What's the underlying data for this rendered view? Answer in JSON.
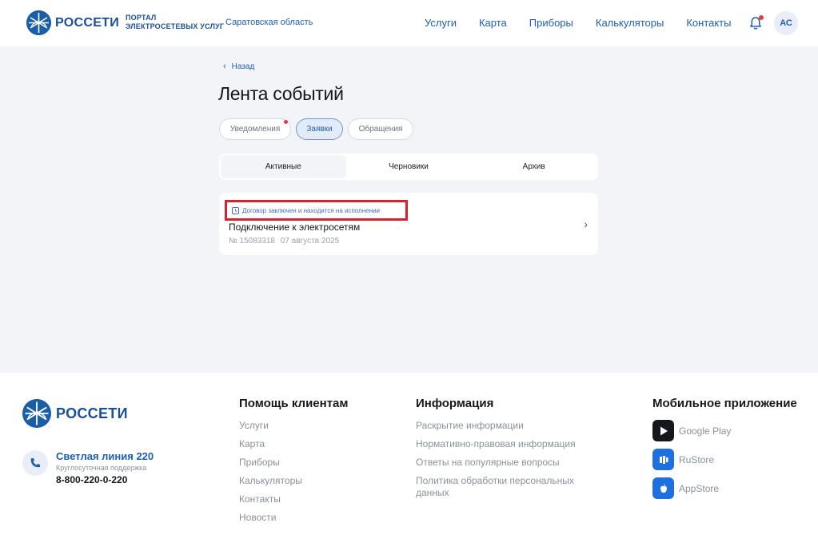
{
  "header": {
    "logo_text": "РОССЕТИ",
    "portal_line1": "ПОРТАЛ",
    "portal_line2": "ЭЛЕКТРОСЕТЕВЫХ УСЛУГ",
    "region": "Саратовская область",
    "nav": [
      "Услуги",
      "Карта",
      "Приборы",
      "Калькуляторы",
      "Контакты"
    ],
    "avatar_initials": "АС"
  },
  "main": {
    "back_label": "Назад",
    "title": "Лента событий",
    "chips": [
      "Уведомления",
      "Заявки",
      "Обращения"
    ],
    "active_chip": "Заявки",
    "subtabs": [
      "Активные",
      "Черновики",
      "Архив"
    ],
    "active_subtab": "Активные",
    "card": {
      "status": "Договор заключен и находится на исполнении",
      "title": "Подключение к электросетям",
      "number": "№ 15083318",
      "date": "07 августа 2025"
    }
  },
  "footer": {
    "logo_text": "РОССЕТИ",
    "hotline_title": "Светлая линия 220",
    "hotline_sub": "Круглосуточная поддержка",
    "hotline_phone": "8-800-220-0-220",
    "help_title": "Помощь клиентам",
    "help_links": [
      "Услуги",
      "Карта",
      "Приборы",
      "Калькуляторы",
      "Контакты",
      "Новости"
    ],
    "info_title": "Информация",
    "info_links": [
      "Раскрытие информации",
      "Нормативно-правовая информация",
      "Ответы на популярные вопросы",
      "Политика обработки персональных данных"
    ],
    "app_title": "Мобильное приложение",
    "apps": [
      "Google Play",
      "RuStore",
      "AppStore"
    ]
  },
  "colors": {
    "accent": "#1e5fb0",
    "brand": "#1b4f95",
    "background": "#f3f4f8",
    "notification_dot": "#e63946",
    "highlight_border": "#d7232f"
  }
}
